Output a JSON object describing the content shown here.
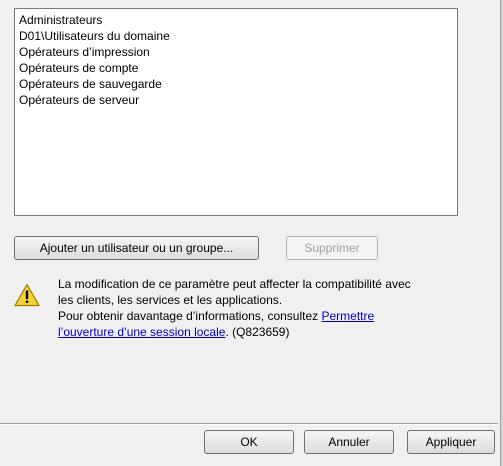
{
  "members_list": {
    "items": [
      "Administrateurs",
      "D01\\Utilisateurs du domaine",
      "Opérateurs d’impression",
      "Opérateurs de compte",
      "Opérateurs de sauvegarde",
      "Opérateurs de serveur"
    ]
  },
  "actions": {
    "add_label": "Ajouter un utilisateur ou un groupe...",
    "remove_label": "Supprimer"
  },
  "warning": {
    "icon": "warning-icon",
    "line1": "La modification de ce paramètre peut affecter la compatibilité avec",
    "line2": "les clients, les services et les applications.",
    "line3_prefix": "Pour obtenir davantage d’informations, consultez ",
    "link_part1": "Permettre",
    "link_part2": "l’ouverture d’une session locale",
    "suffix": ". (Q823659)"
  },
  "footer": {
    "ok_label": "OK",
    "cancel_label": "Annuler",
    "apply_label": "Appliquer"
  }
}
